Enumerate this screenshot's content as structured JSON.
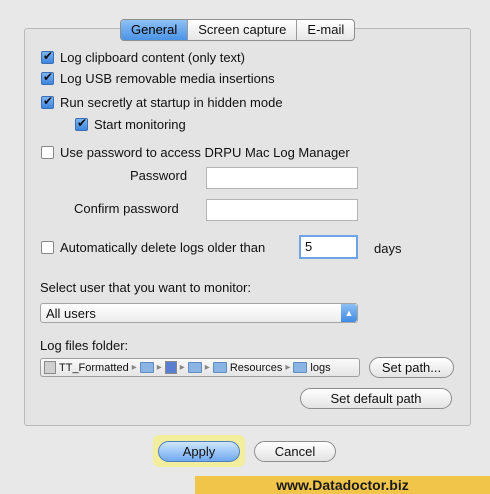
{
  "tabs": [
    "General",
    "Screen capture",
    "E-mail"
  ],
  "options": {
    "log_clipboard": "Log clipboard content (only text)",
    "log_usb": "Log USB removable media insertions",
    "run_secretly": "Run secretly at startup in hidden mode",
    "start_monitoring": "Start monitoring",
    "use_password": "Use password to access DRPU Mac Log Manager"
  },
  "password": {
    "label": "Password",
    "confirm_label": "Confirm password"
  },
  "auto_delete": {
    "label": "Automatically delete logs older than",
    "value": "5",
    "unit": "days"
  },
  "user_select": {
    "label": "Select user that you want to monitor:",
    "value": "All users"
  },
  "log_folder": {
    "label": "Log files folder:",
    "path": [
      "TT_Formatted",
      "",
      "",
      "",
      "Resources",
      "logs"
    ],
    "set_path": "Set path...",
    "set_default": "Set default path"
  },
  "buttons": {
    "apply": "Apply",
    "cancel": "Cancel"
  },
  "footer": "www.Datadoctor.biz"
}
